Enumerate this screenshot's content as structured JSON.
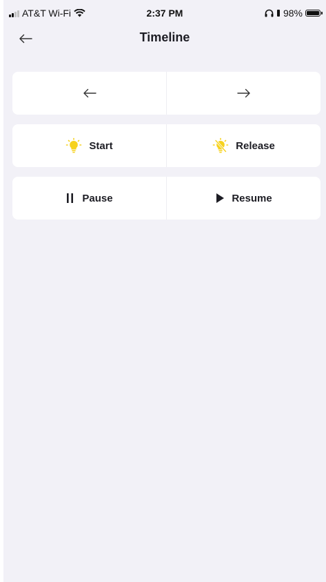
{
  "status_bar": {
    "carrier": "AT&T Wi-Fi",
    "time": "2:37 PM",
    "battery_percent": "98%",
    "battery_level": 0.98
  },
  "nav": {
    "title": "Timeline",
    "back_icon": "arrow-left-icon"
  },
  "controls": {
    "prev_icon": "arrow-left-icon",
    "next_icon": "arrow-right-icon",
    "start_label": "Start",
    "release_label": "Release",
    "pause_label": "Pause",
    "resume_label": "Resume"
  },
  "colors": {
    "background": "#f2f1f7",
    "card": "#ffffff",
    "accent_yellow": "#f6d21e",
    "text": "#1d1d24"
  }
}
